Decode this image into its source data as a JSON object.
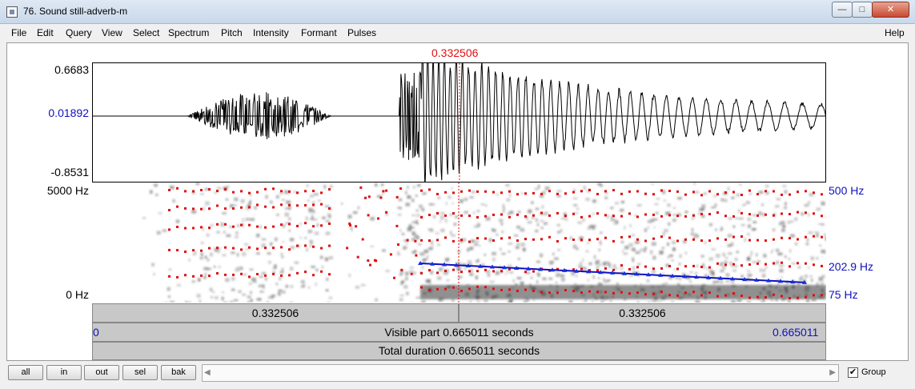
{
  "window": {
    "title": "76. Sound still-adverb-m",
    "minimize": "—",
    "maximize": "□",
    "close": "✕"
  },
  "menu": [
    "File",
    "Edit",
    "Query",
    "View",
    "Select",
    "Spectrum",
    "Pitch",
    "Intensity",
    "Formant",
    "Pulses",
    "Help"
  ],
  "waveform": {
    "max": "0.6683",
    "cursor_value": "0.01892",
    "min": "-0.8531"
  },
  "spectrogram": {
    "freq_top": "5000 Hz",
    "freq_bottom": "0 Hz",
    "pitch_top": "500 Hz",
    "pitch_current": "202.9 Hz",
    "pitch_bottom": "75 Hz"
  },
  "cursor": {
    "time": "0.332506"
  },
  "selection": {
    "left_duration": "0.332506",
    "right_duration": "0.332506"
  },
  "visible": {
    "start": "0",
    "label": "Visible part 0.665011 seconds",
    "end": "0.665011"
  },
  "total": {
    "label": "Total duration 0.665011 seconds"
  },
  "zoom_buttons": [
    "all",
    "in",
    "out",
    "sel",
    "bak"
  ],
  "group": {
    "checked": "✔",
    "label": "Group"
  },
  "colors": {
    "cursor": "#e01010",
    "pitch": "#1010c0",
    "formant": "#e01010"
  }
}
